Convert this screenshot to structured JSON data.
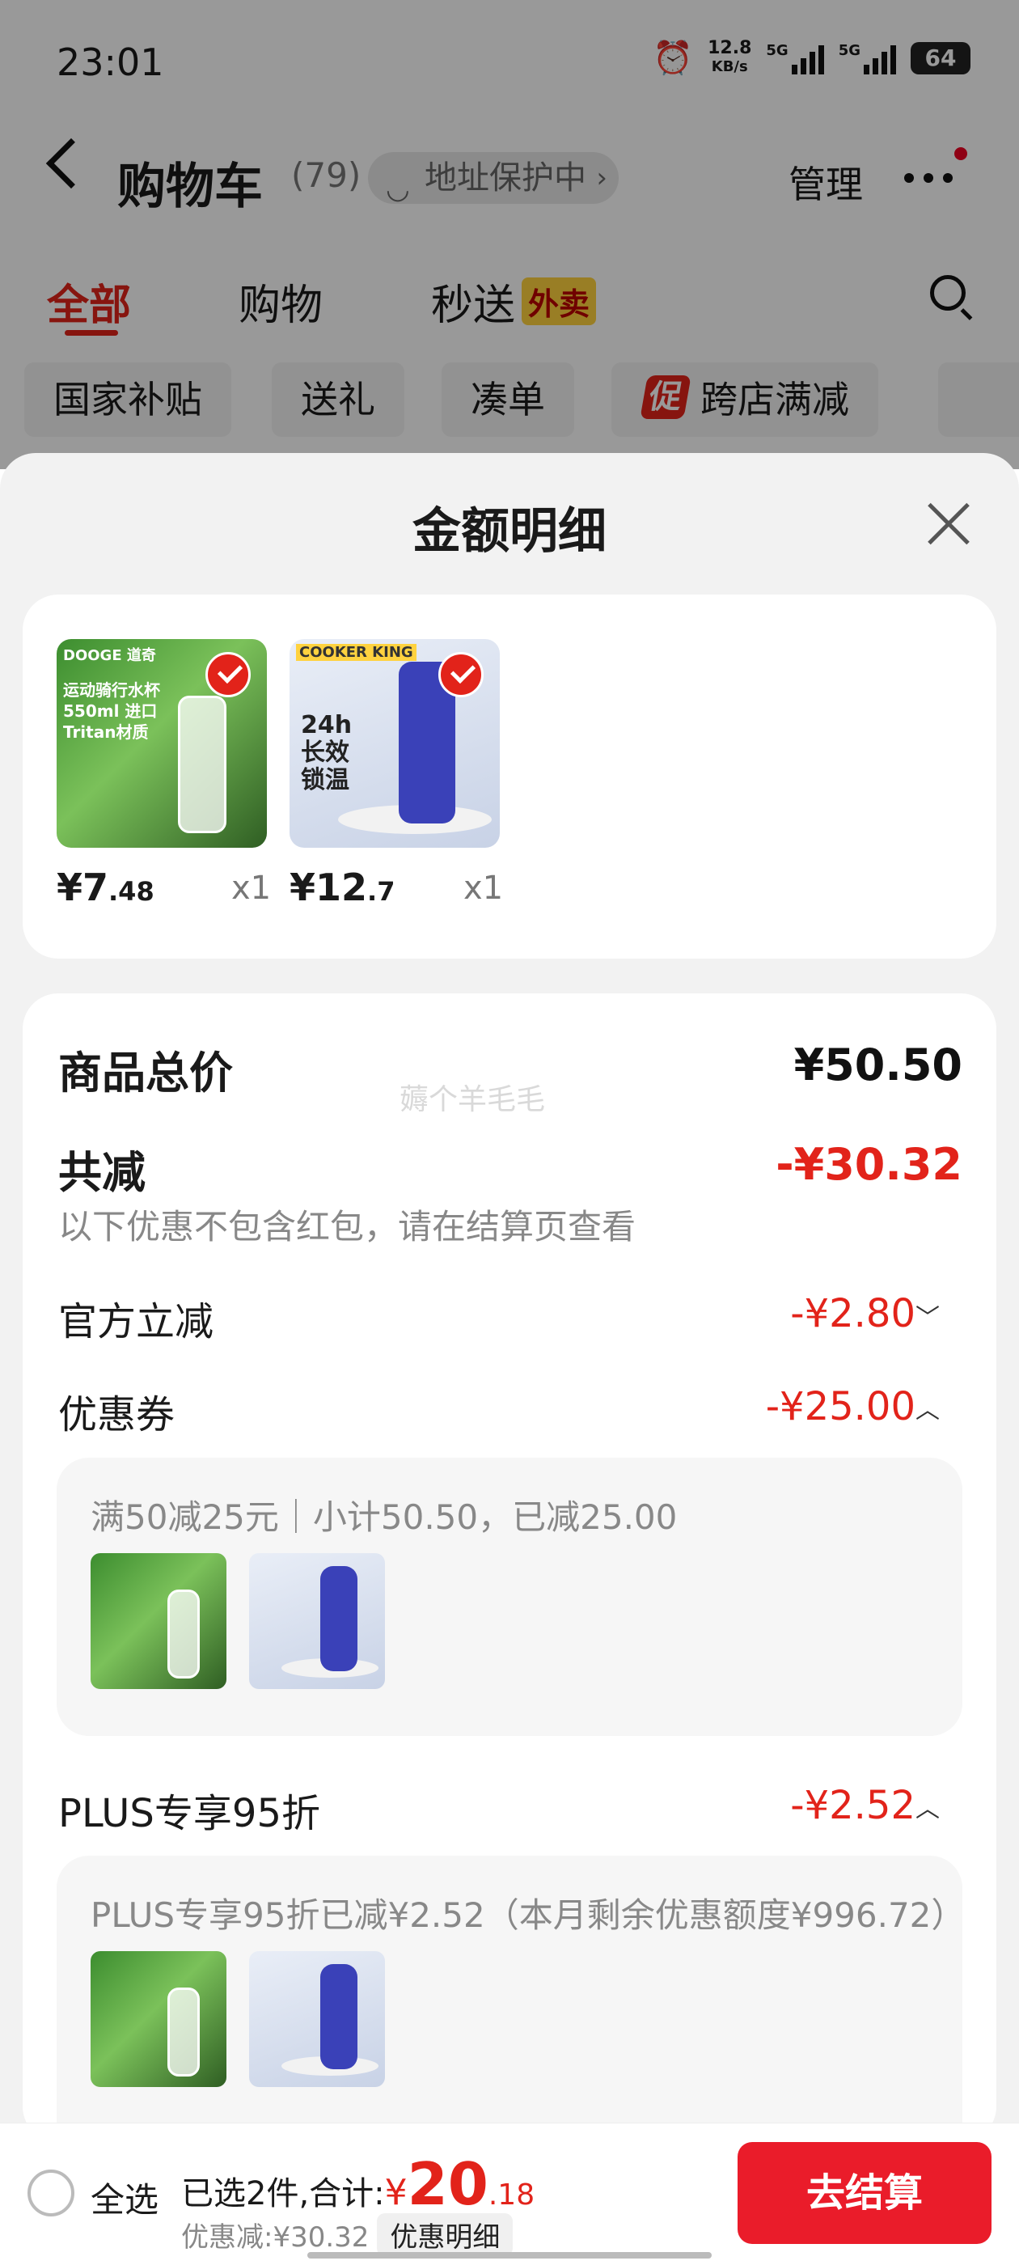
{
  "status_bar": {
    "time": "23:01",
    "net_speed": "12.8",
    "net_unit": "KB/s",
    "net_5g_1": "5G",
    "net_5g_2": "5G",
    "battery": "64"
  },
  "header": {
    "title": "购物车",
    "count": "(79)",
    "address": "地址保护中",
    "manage": "管理"
  },
  "tabs": [
    {
      "label": "全部"
    },
    {
      "label": "购物"
    },
    {
      "label": "秒送",
      "badge": "外卖"
    }
  ],
  "chips": [
    "国家补贴",
    "送礼",
    "凑单",
    "跨店满减"
  ],
  "promo_badge": "促",
  "sheet": {
    "title": "金额明细",
    "products": [
      {
        "price_int": "¥7",
        "price_dec": ".48",
        "qty": "x1",
        "brand": "DOOGE 道奇",
        "caption": "运动骑行水杯550ml 进口Tritan材质"
      },
      {
        "price_int": "¥12",
        "price_dec": ".7",
        "qty": "x1",
        "brand": "COOKER KING",
        "caption": "24h 长效锁温"
      }
    ],
    "total_label": "商品总价",
    "total_value": "¥50.50",
    "reduce_label": "共减",
    "reduce_value": "-¥30.32",
    "reduce_note": "以下优惠不包含红包，请在结算页查看",
    "watermark": "薅个羊毛毛",
    "official_label": "官方立减",
    "official_value": "-¥2.80",
    "coupon_label": "优惠券",
    "coupon_value": "-¥25.00",
    "coupon_detail": "满50减25元｜小计50.50，已减25.00",
    "plus_label": "PLUS专享95折",
    "plus_value": "-¥2.52",
    "plus_detail": "PLUS专享95折已减¥2.52（本月剩余优惠额度¥996.72）"
  },
  "bottom": {
    "select_all": "全选",
    "selected_text": "已选2件,合计:",
    "total_yen": "¥",
    "total_int": "20",
    "total_dec": ".18",
    "discount_text": "优惠减:¥30.32",
    "detail_button": "优惠明细",
    "checkout": "去结算"
  },
  "colors": {
    "accent": "#e2231a",
    "checkout": "#ea1c2a"
  }
}
